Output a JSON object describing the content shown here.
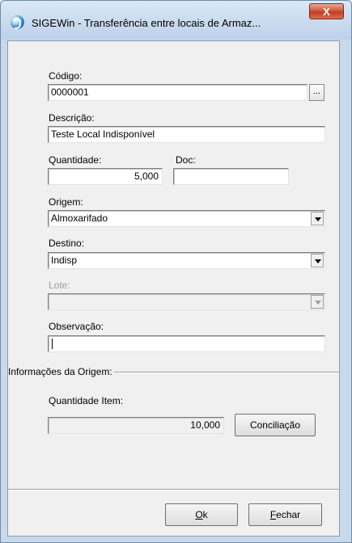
{
  "window": {
    "title": "SIGEWin - Transferência entre locais de Armaz...",
    "close_glyph": "X",
    "icon": "sigewin-app-icon"
  },
  "form": {
    "codigo": {
      "label": "Código:",
      "value": "0000001",
      "browse_label": "..."
    },
    "descricao": {
      "label": "Descrição:",
      "value": "Teste Local Indisponível"
    },
    "quantidade": {
      "label": "Quantidade:",
      "value": "5,000"
    },
    "doc": {
      "label": "Doc:",
      "value": ""
    },
    "origem": {
      "label": "Origem:",
      "value": "Almoxarifado"
    },
    "destino": {
      "label": "Destino:",
      "value": "Indisp"
    },
    "lote": {
      "label": "Lote:",
      "value": ""
    },
    "observacao": {
      "label": "Observação:",
      "value": ""
    }
  },
  "origin_info": {
    "group_label": "Informações da Origem:",
    "quantidade_item": {
      "label": "Quantidade Item:",
      "value": "10,000"
    },
    "conciliacao_label": "Conciliação"
  },
  "buttons": {
    "ok": {
      "accel": "O",
      "rest": "k"
    },
    "fechar": {
      "accel": "F",
      "rest": "echar"
    }
  }
}
